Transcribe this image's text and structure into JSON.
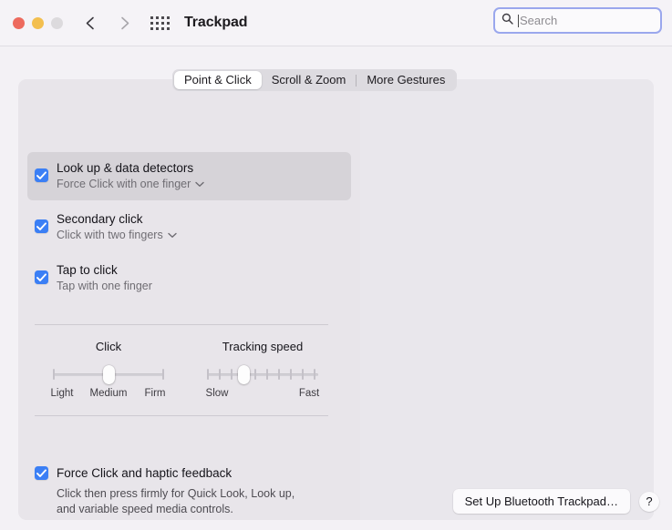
{
  "window": {
    "title": "Trackpad",
    "traffic_lights": [
      "close-button",
      "minimize-button",
      "zoom-button"
    ],
    "back_label": "Back",
    "forward_label": "Forward",
    "grid_label": "Show All"
  },
  "search": {
    "placeholder": "Search",
    "value": "",
    "focused": true,
    "accent": "#9aa7ed"
  },
  "tabs": [
    {
      "label": "Point & Click",
      "active": true
    },
    {
      "label": "Scroll & Zoom",
      "active": false
    },
    {
      "label": "More Gestures",
      "active": false
    }
  ],
  "options": [
    {
      "title": "Look up & data detectors",
      "subtitle": "Force Click with one finger",
      "checked": true,
      "has_popup": true,
      "selected": true
    },
    {
      "title": "Secondary click",
      "subtitle": "Click with two fingers",
      "checked": true,
      "has_popup": true,
      "selected": false
    },
    {
      "title": "Tap to click",
      "subtitle": "Tap with one finger",
      "checked": true,
      "has_popup": false,
      "selected": false
    }
  ],
  "sliders": [
    {
      "label": "Click",
      "min_label": "Light",
      "mid_label": "Medium",
      "max_label": "Firm",
      "ticks": 3,
      "value_index": 1,
      "value_label": "Medium"
    },
    {
      "label": "Tracking speed",
      "min_label": "Slow",
      "max_label": "Fast",
      "ticks": 10,
      "value_index": 3,
      "value_label": "Slow-Medium"
    }
  ],
  "force_click": {
    "title": "Force Click and haptic feedback",
    "checked": true,
    "description_line1": "Click then press firmly for Quick Look, Look up,",
    "description_line2": "and variable speed media controls."
  },
  "bottom": {
    "setup_label": "Set Up Bluetooth Trackpad…",
    "help_label": "?"
  },
  "colors": {
    "checkbox_blue": "#3b7ff5",
    "window_bg": "#f3f1f5",
    "card_bg": "#e8e5ea",
    "row_selected": "#d6d3d8"
  }
}
